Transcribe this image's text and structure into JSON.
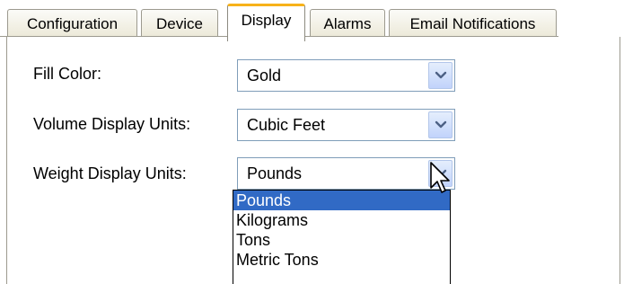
{
  "tabs": [
    {
      "label": "Configuration"
    },
    {
      "label": "Device"
    },
    {
      "label": "Display",
      "active": true
    },
    {
      "label": "Alarms"
    },
    {
      "label": "Email Notifications"
    }
  ],
  "form": {
    "fill_color": {
      "label": "Fill Color:",
      "value": "Gold"
    },
    "volume_units": {
      "label": "Volume Display Units:",
      "value": "Cubic Feet"
    },
    "weight_units": {
      "label": "Weight Display Units:",
      "value": "Pounds"
    }
  },
  "weight_dropdown": {
    "options": [
      "Pounds",
      "Kilograms",
      "Tons",
      "Metric Tons"
    ],
    "selected": "Pounds"
  },
  "colors": {
    "active_tab_accent": "#f7b21a",
    "selection": "#316ac5",
    "combo_border": "#7f9db9"
  },
  "icons": {
    "combo_button": "chevron-down-icon",
    "cursor": "mouse-pointer-icon"
  }
}
